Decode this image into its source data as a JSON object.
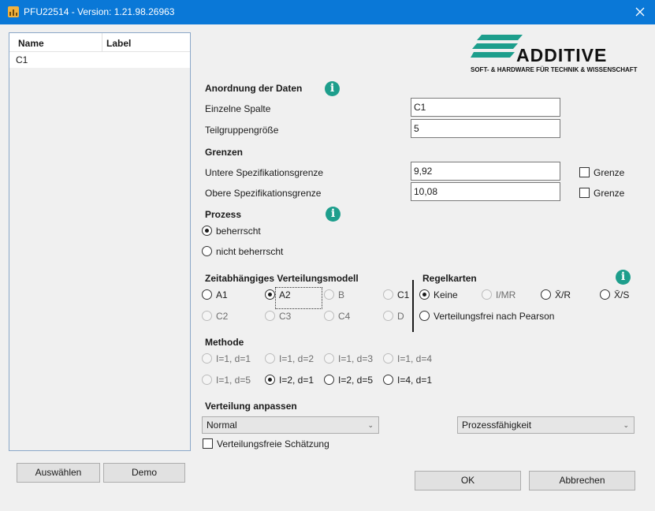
{
  "window": {
    "title": "PFU22514 - Version: 1.21.98.26963"
  },
  "list": {
    "col_name": "Name",
    "col_label": "Label",
    "rows": [
      {
        "name": "C1",
        "label": ""
      }
    ]
  },
  "buttons": {
    "select": "Auswählen",
    "demo": "Demo",
    "ok": "OK",
    "cancel": "Abbrechen"
  },
  "logo": {
    "name": "ADDITIVE",
    "tagline": "SOFT- & HARDWARE FÜR TECHNIK & WISSENSCHAFT",
    "color": "#1d9e8c"
  },
  "data_arrangement": {
    "heading": "Anordnung der Daten",
    "single_column_label": "Einzelne Spalte",
    "single_column_value": "C1",
    "subgroup_label": "Teilgruppengröße",
    "subgroup_value": "5"
  },
  "limits": {
    "heading": "Grenzen",
    "lower_label": "Untere Spezifikationsgrenze",
    "lower_value": "9,92",
    "lower_check_label": "Grenze",
    "upper_label": "Obere Spezifikationsgrenze",
    "upper_value": "10,08",
    "upper_check_label": "Grenze"
  },
  "process": {
    "heading": "Prozess",
    "controlled": "beherrscht",
    "not_controlled": "nicht beherrscht",
    "selected": "controlled"
  },
  "model": {
    "heading": "Zeitabhängiges Verteilungsmodell",
    "options": [
      "A1",
      "A2",
      "B",
      "C1",
      "C2",
      "C3",
      "C4",
      "D"
    ],
    "selected": "A2"
  },
  "control_charts": {
    "heading": "Regelkarten",
    "options": [
      "Keine",
      "I/MR",
      "X̄/R",
      "X̄/S"
    ],
    "pearson": "Verteilungsfrei nach Pearson",
    "selected": "Keine"
  },
  "method": {
    "heading": "Methode",
    "options": [
      "I=1, d=1",
      "I=1, d=2",
      "I=1, d=3",
      "I=1, d=4",
      "I=1, d=5",
      "I=2, d=1",
      "I=2, d=5",
      "I=4, d=1"
    ],
    "selected": "I=2, d=1"
  },
  "fit": {
    "heading": "Verteilung anpassen",
    "distribution": "Normal",
    "capability": "Prozessfähigkeit",
    "free_estimate": "Verteilungsfreie Schätzung"
  }
}
